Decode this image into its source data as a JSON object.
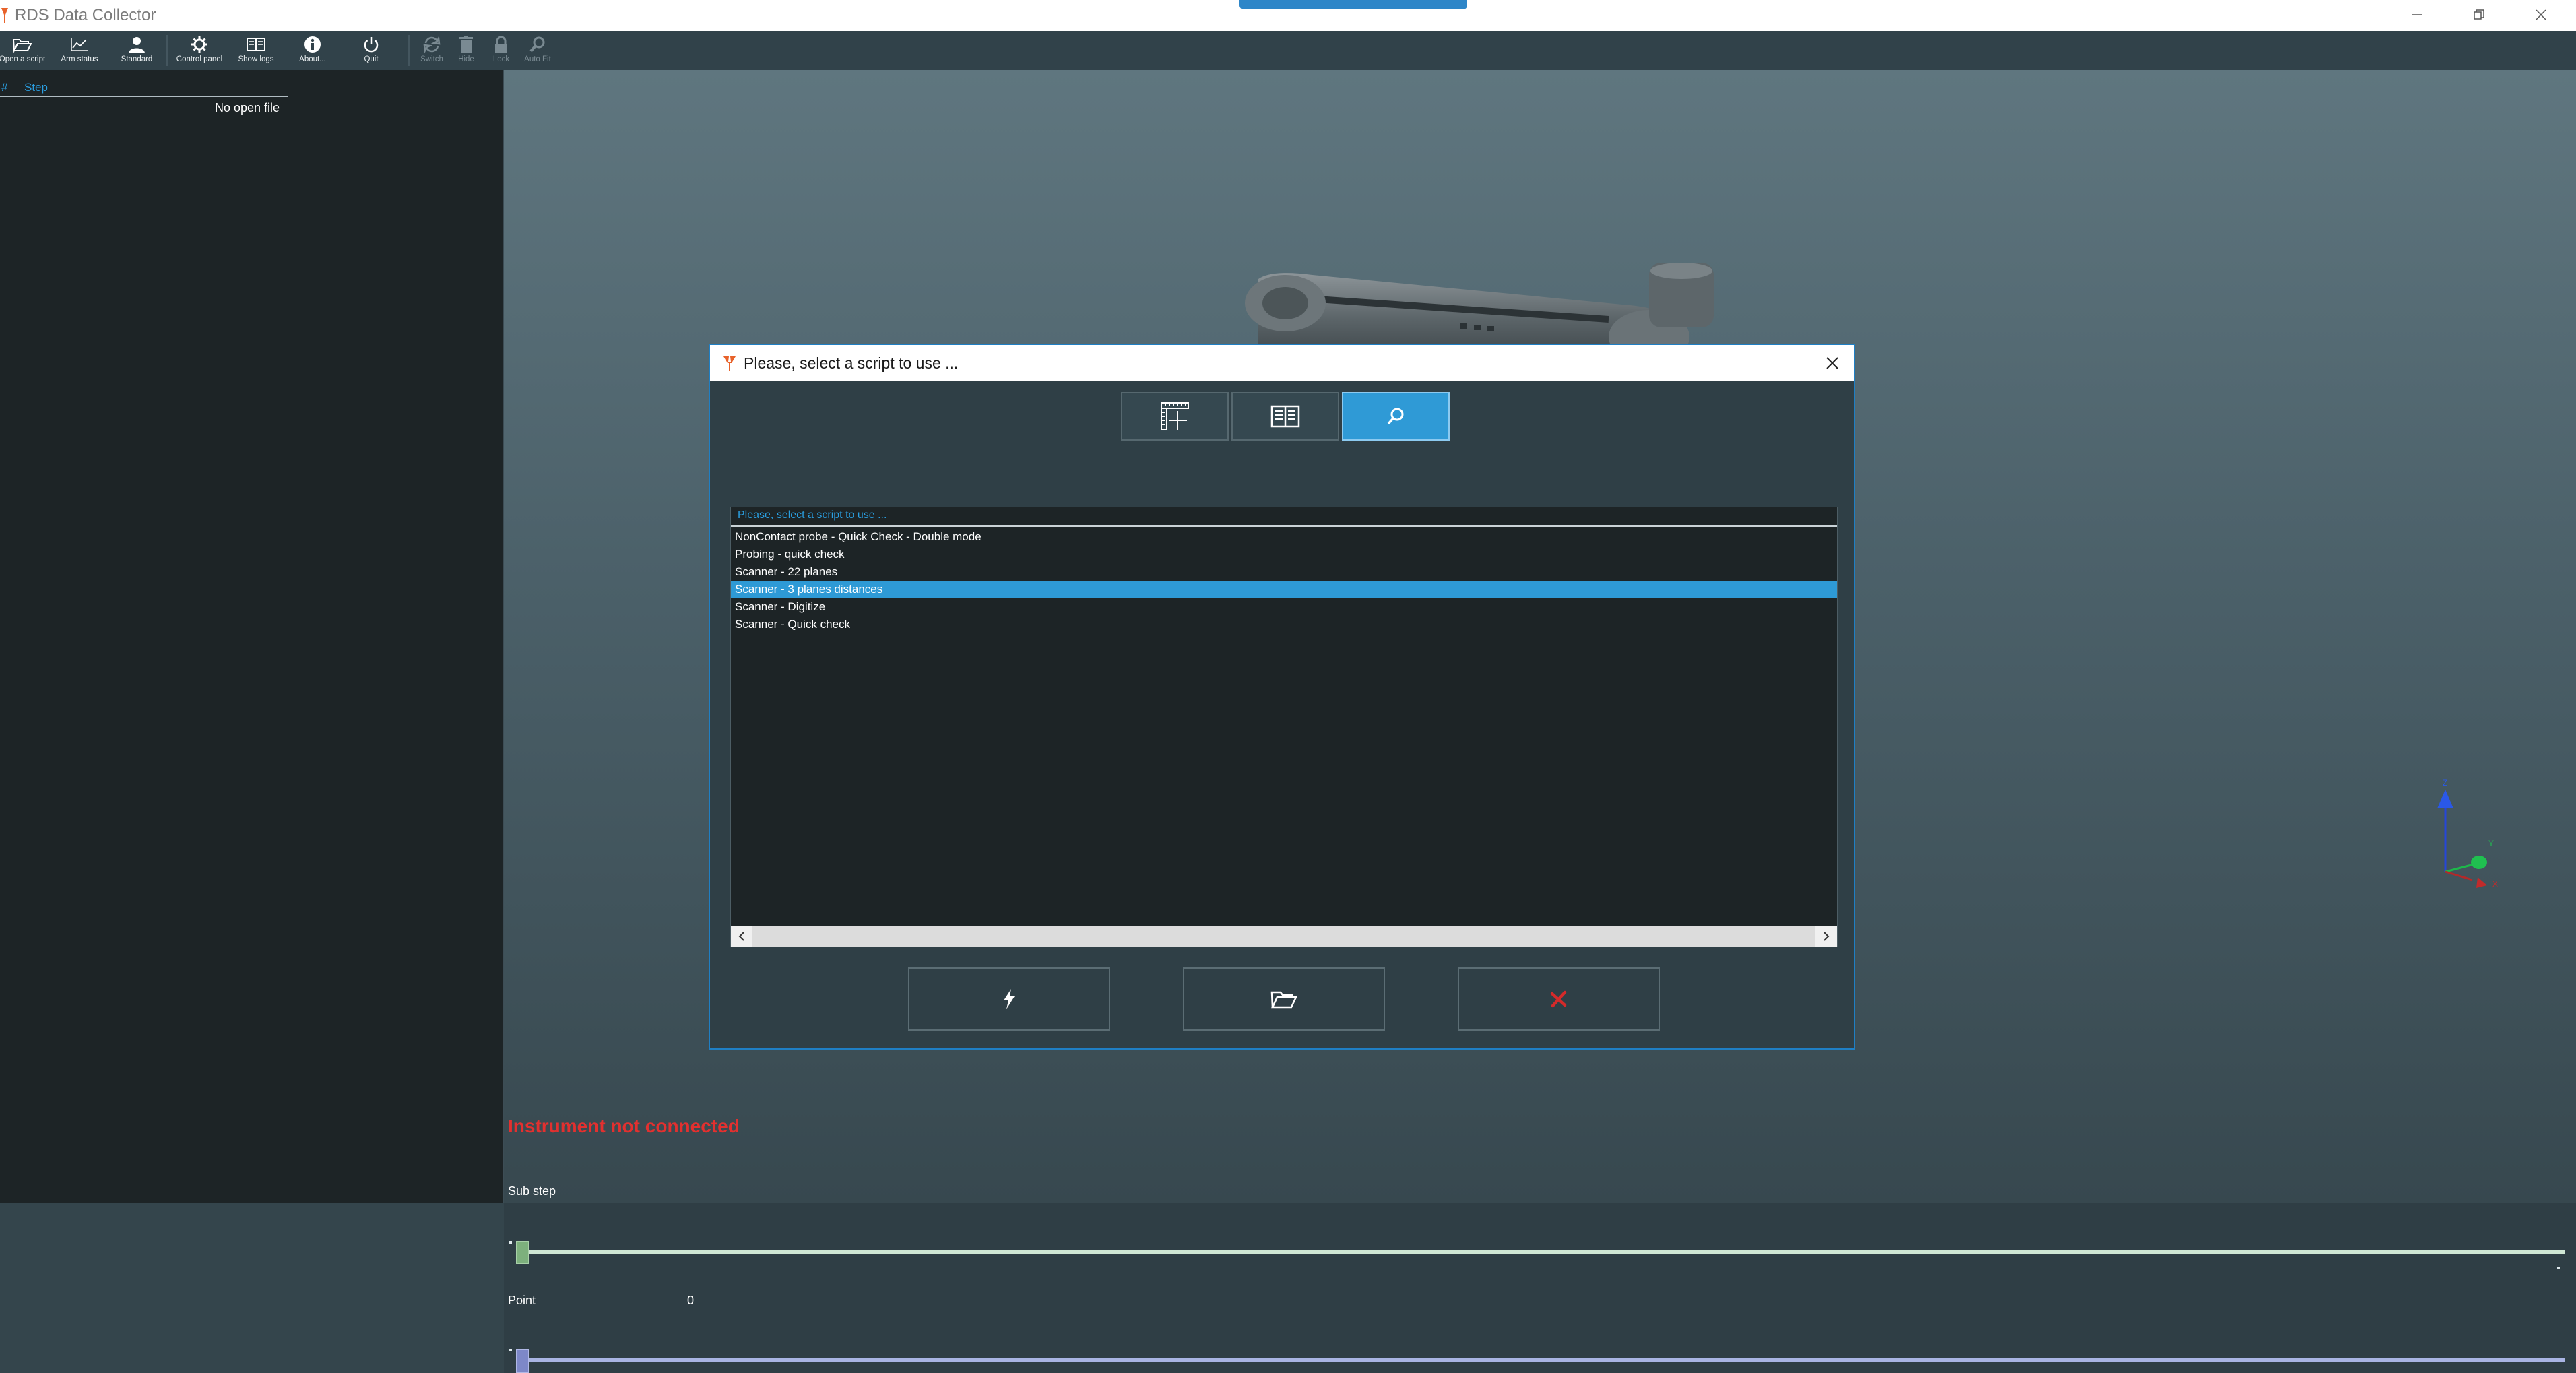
{
  "window": {
    "title": "RDS Data Collector"
  },
  "toolbar": {
    "buttons": [
      {
        "label": "Open a script",
        "icon": "folder-open-icon"
      },
      {
        "label": "Arm status",
        "icon": "chart-icon"
      },
      {
        "label": "Standard",
        "icon": "user-icon"
      },
      {
        "label": "Control panel",
        "icon": "gear-icon"
      },
      {
        "label": "Show logs",
        "icon": "logs-icon"
      },
      {
        "label": "About...",
        "icon": "info-icon"
      },
      {
        "label": "Quit",
        "icon": "power-icon"
      },
      {
        "label": "Switch",
        "icon": "switch-icon",
        "disabled": true
      },
      {
        "label": "Hide",
        "icon": "trash-icon",
        "disabled": true
      },
      {
        "label": "Lock",
        "icon": "lock-icon",
        "disabled": true
      },
      {
        "label": "Auto Fit",
        "icon": "zoom-icon",
        "disabled": true
      }
    ]
  },
  "steps_panel": {
    "col_number": "#",
    "col_step": "Step",
    "empty_message": "No open file"
  },
  "dialog": {
    "title": "Please, select a script to use ...",
    "mode_buttons": [
      {
        "icon": "ruler-icon",
        "active": false
      },
      {
        "icon": "book-icon",
        "active": false
      },
      {
        "icon": "search-icon",
        "active": true
      }
    ],
    "list_placeholder": "Please, select a script to use ...",
    "scripts": [
      "NonContact probe - Quick Check - Double mode",
      "Probing - quick check",
      "Scanner - 22 planes",
      "Scanner - 3 planes distances",
      "Scanner - Digitize",
      "Scanner - Quick check"
    ],
    "selected_index": 3,
    "actions": [
      {
        "icon": "lightning-icon"
      },
      {
        "icon": "folder-icon"
      },
      {
        "icon": "cancel-x-icon"
      }
    ]
  },
  "status": {
    "instrument": "Instrument not connected"
  },
  "axes": {
    "z": "Z",
    "y": "Y",
    "x": "X"
  },
  "substep": {
    "label": "Sub step"
  },
  "point": {
    "label": "Point",
    "value": "0"
  },
  "colors": {
    "accent": "#2e9ad6",
    "error": "#e3302f",
    "panel": "#1d2426",
    "toolbar": "#31424a"
  }
}
